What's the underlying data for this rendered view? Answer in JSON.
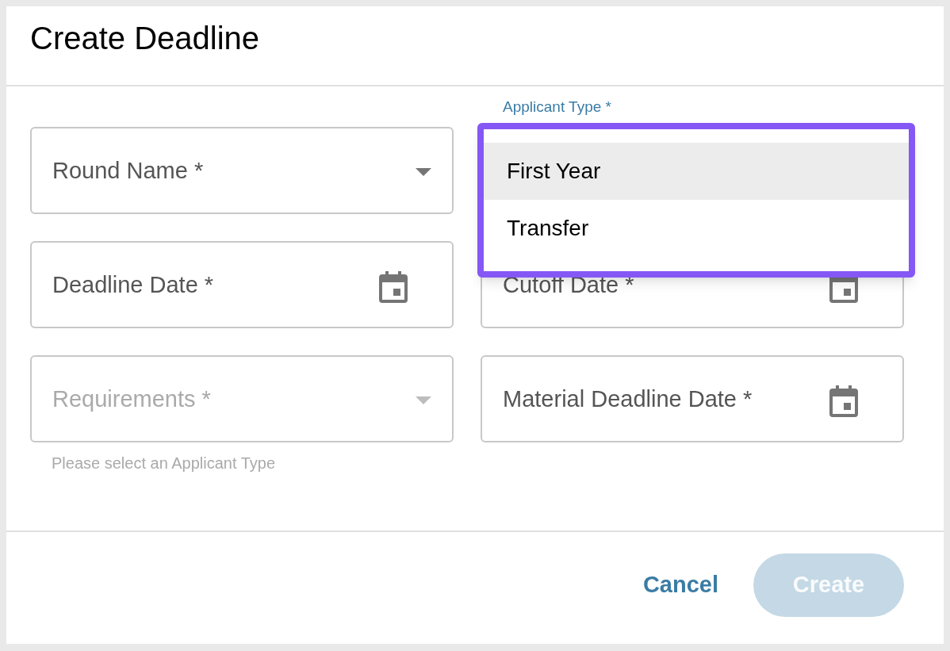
{
  "dialog": {
    "title": "Create Deadline"
  },
  "applicant_type": {
    "label": "Applicant Type *",
    "options": [
      {
        "label": "First Year",
        "selected": true
      },
      {
        "label": "Transfer",
        "selected": false
      }
    ]
  },
  "fields": [
    {
      "kind": "select",
      "label": "Round Name *",
      "disabled": false
    },
    {
      "kind": "date",
      "label": "Deadline Date *",
      "disabled": false
    },
    {
      "kind": "date",
      "label": "Cutoff Date *",
      "disabled": false
    },
    {
      "kind": "select",
      "label": "Requirements *",
      "disabled": true,
      "helper": "Please select an Applicant Type"
    },
    {
      "kind": "date",
      "label": "Material Deadline Date *",
      "disabled": false
    }
  ],
  "buttons": [
    {
      "label": "Cancel",
      "kind": "text",
      "disabled": false
    },
    {
      "label": "Create",
      "kind": "filled",
      "disabled": true
    }
  ]
}
